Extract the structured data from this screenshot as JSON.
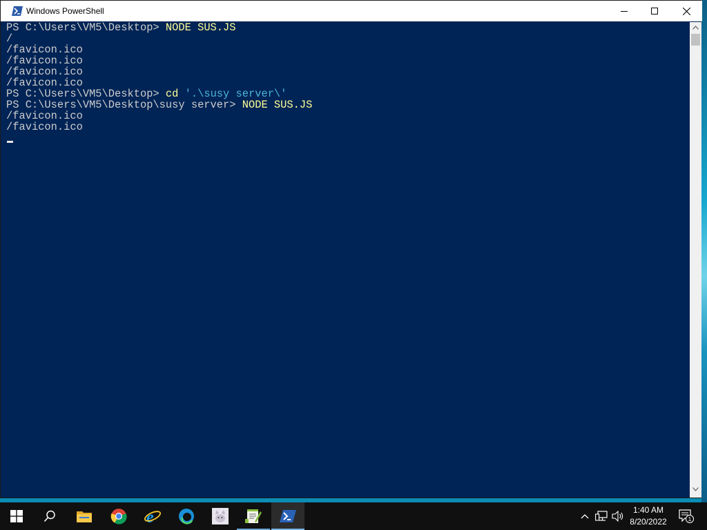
{
  "window": {
    "title": "Windows PowerShell"
  },
  "console": {
    "lines": [
      {
        "segments": [
          {
            "text": "PS C:\\Users\\VM5\\Desktop> ",
            "style": "out"
          },
          {
            "text": "NODE SUS.JS",
            "style": "cmd"
          }
        ]
      },
      {
        "segments": [
          {
            "text": "/",
            "style": "out"
          }
        ]
      },
      {
        "segments": [
          {
            "text": "/favicon.ico",
            "style": "out"
          }
        ]
      },
      {
        "segments": [
          {
            "text": "/favicon.ico",
            "style": "out"
          }
        ]
      },
      {
        "segments": [
          {
            "text": "/favicon.ico",
            "style": "out"
          }
        ]
      },
      {
        "segments": [
          {
            "text": "/favicon.ico",
            "style": "out"
          }
        ]
      },
      {
        "segments": [
          {
            "text": "PS C:\\Users\\VM5\\Desktop> ",
            "style": "out"
          },
          {
            "text": "cd ",
            "style": "cmd"
          },
          {
            "text": "'.\\susy server\\'",
            "style": "str"
          }
        ]
      },
      {
        "segments": [
          {
            "text": "PS C:\\Users\\VM5\\Desktop\\susy server> ",
            "style": "out"
          },
          {
            "text": "NODE SUS.JS",
            "style": "cmd"
          }
        ]
      },
      {
        "segments": [
          {
            "text": "/favicon.ico",
            "style": "out"
          }
        ]
      },
      {
        "segments": [
          {
            "text": "/favicon.ico",
            "style": "out"
          }
        ]
      }
    ]
  },
  "taskbar": {
    "apps": [
      {
        "name": "start-button",
        "icon": "windows-logo-icon"
      },
      {
        "name": "search-button",
        "icon": "search-icon"
      },
      {
        "name": "file-explorer-button",
        "icon": "folder-icon"
      },
      {
        "name": "chrome-button",
        "icon": "chrome-icon"
      },
      {
        "name": "internet-explorer-button",
        "icon": "internet-explorer-icon"
      },
      {
        "name": "edge-button",
        "icon": "edge-icon"
      },
      {
        "name": "cat-app-button",
        "icon": "cat-icon"
      },
      {
        "name": "notepad-plus-button",
        "icon": "notepad-plus-icon"
      },
      {
        "name": "powershell-button",
        "icon": "powershell-icon",
        "active": true
      }
    ],
    "clock": {
      "time": "1:40 AM",
      "date": "8/20/2022"
    },
    "notifications": {
      "count": "1"
    }
  },
  "colors": {
    "console_bg": "#012456",
    "console_text": "#cccccc",
    "command": "#ffff96",
    "string": "#4cb5d8",
    "taskbar": "#101010",
    "accent": "#76b9ed"
  }
}
